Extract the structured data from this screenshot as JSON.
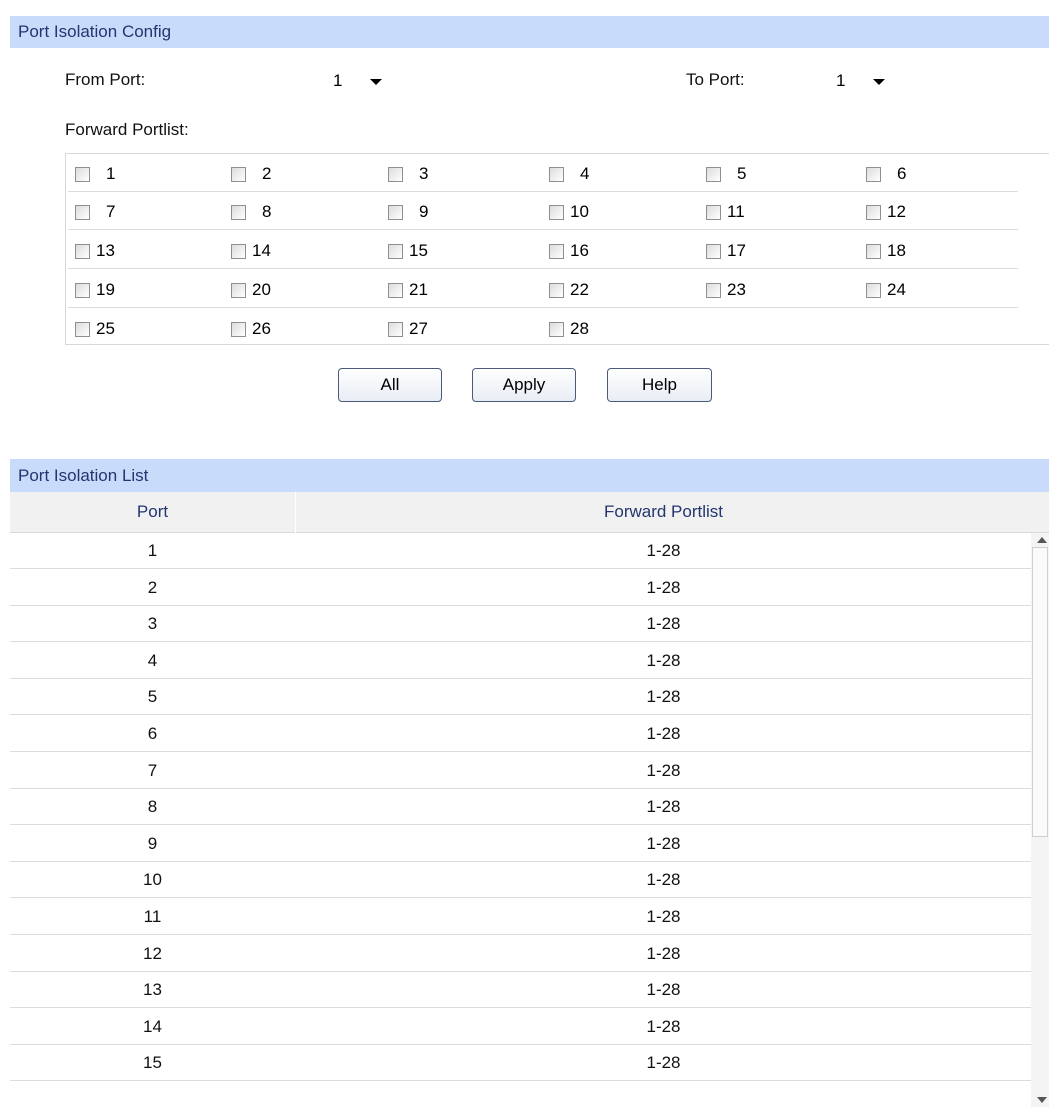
{
  "config": {
    "title": "Port Isolation Config",
    "from_port_label": "From Port:",
    "from_port_value": "1",
    "to_port_label": "To Port:",
    "to_port_value": "1",
    "forward_portlist_label": "Forward Portlist:",
    "ports": [
      "1",
      "2",
      "3",
      "4",
      "5",
      "6",
      "7",
      "8",
      "9",
      "10",
      "11",
      "12",
      "13",
      "14",
      "15",
      "16",
      "17",
      "18",
      "19",
      "20",
      "21",
      "22",
      "23",
      "24",
      "25",
      "26",
      "27",
      "28"
    ],
    "ports_checked": false
  },
  "buttons": {
    "all": "All",
    "apply": "Apply",
    "help": "Help"
  },
  "list": {
    "title": "Port Isolation List",
    "columns": [
      "Port",
      "Forward Portlist"
    ],
    "rows": [
      {
        "port": "1",
        "forward": "1-28"
      },
      {
        "port": "2",
        "forward": "1-28"
      },
      {
        "port": "3",
        "forward": "1-28"
      },
      {
        "port": "4",
        "forward": "1-28"
      },
      {
        "port": "5",
        "forward": "1-28"
      },
      {
        "port": "6",
        "forward": "1-28"
      },
      {
        "port": "7",
        "forward": "1-28"
      },
      {
        "port": "8",
        "forward": "1-28"
      },
      {
        "port": "9",
        "forward": "1-28"
      },
      {
        "port": "10",
        "forward": "1-28"
      },
      {
        "port": "11",
        "forward": "1-28"
      },
      {
        "port": "12",
        "forward": "1-28"
      },
      {
        "port": "13",
        "forward": "1-28"
      },
      {
        "port": "14",
        "forward": "1-28"
      },
      {
        "port": "15",
        "forward": "1-28"
      }
    ]
  },
  "colors": {
    "header_bg": "#c9dbfb",
    "header_text": "#24356f",
    "table_head_bg": "#f1f1f1"
  }
}
